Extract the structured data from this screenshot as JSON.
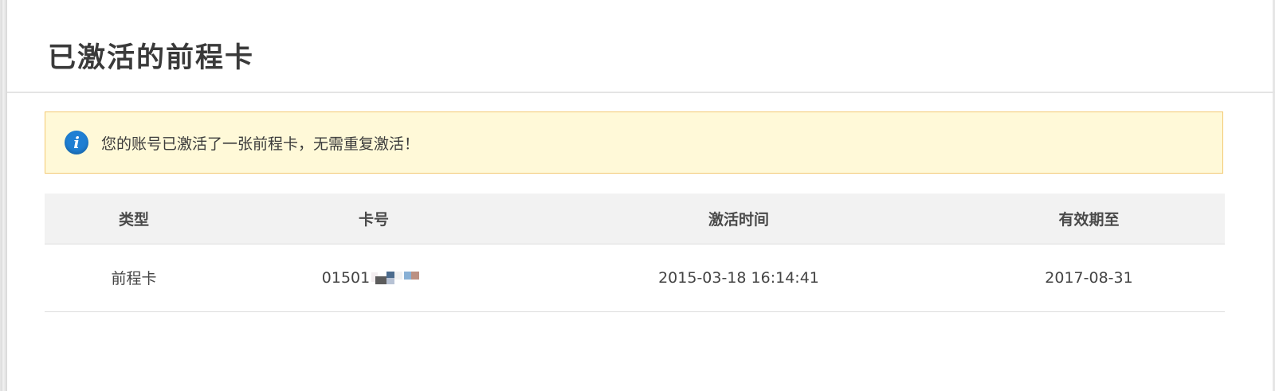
{
  "page": {
    "title": "已激活的前程卡"
  },
  "notice": {
    "icon": "info-icon",
    "icon_glyph": "i",
    "text": "您的账号已激活了一张前程卡，无需重复激活！",
    "colors": {
      "background": "#fff9d8",
      "border": "#f3c973",
      "icon": "#1f7fd3"
    }
  },
  "table": {
    "columns": [
      "类型",
      "卡号",
      "激活时间",
      "有效期至"
    ],
    "rows": [
      {
        "type": "前程卡",
        "card_number_visible": "01501",
        "activated_at": "2015-03-18 16:14:41",
        "valid_until": "2017-08-31"
      }
    ]
  }
}
